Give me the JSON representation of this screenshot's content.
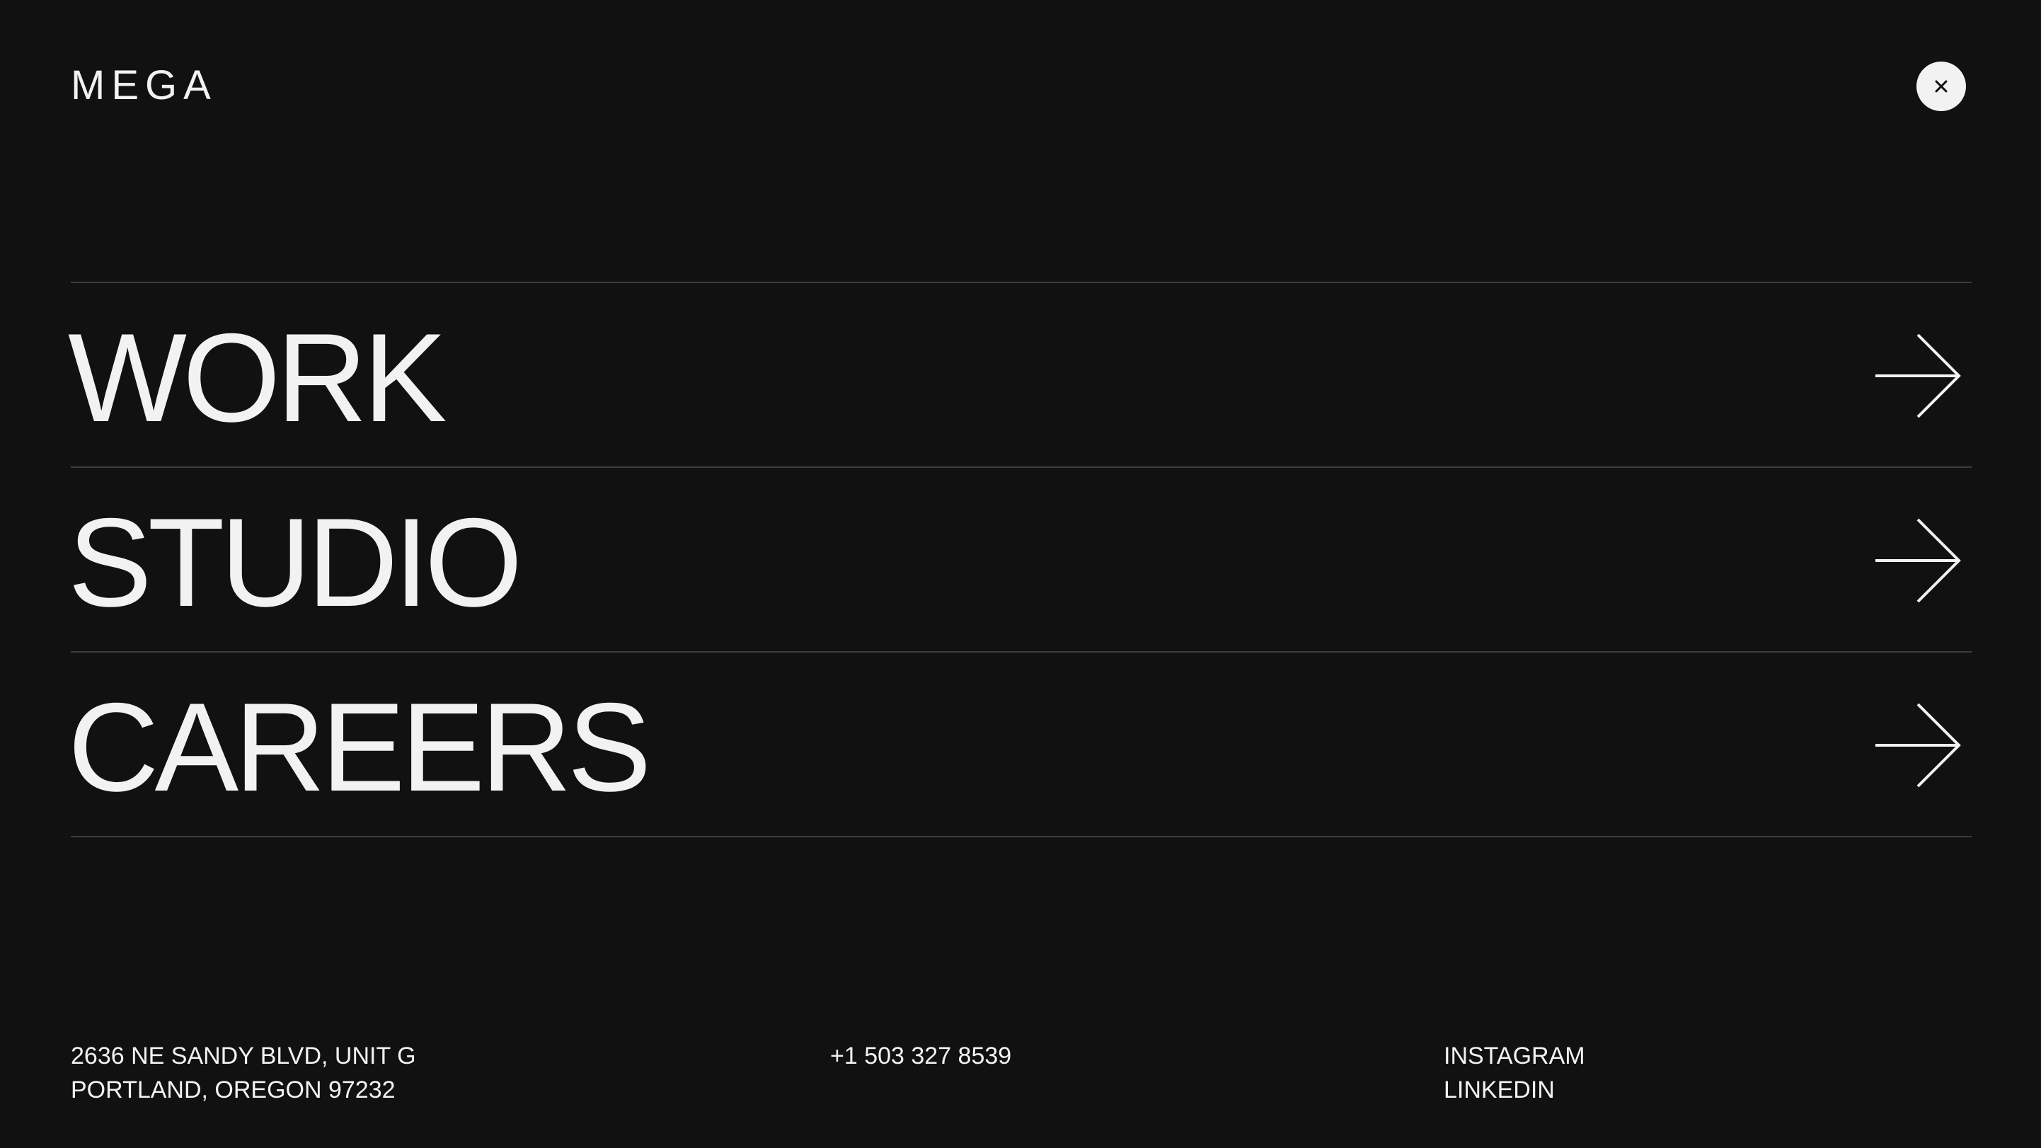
{
  "header": {
    "logo": "MEGA",
    "close_icon": "close-icon"
  },
  "nav": {
    "items": [
      {
        "label": "WORK",
        "icon": "arrow-right-icon"
      },
      {
        "label": "STUDIO",
        "icon": "arrow-right-icon"
      },
      {
        "label": "CAREERS",
        "icon": "arrow-right-icon"
      }
    ]
  },
  "footer": {
    "address": {
      "line1": "2636 NE SANDY BLVD, UNIT G",
      "line2": "PORTLAND, OREGON 97232"
    },
    "phone": "+1 503 327 8539",
    "social": {
      "instagram": "INSTAGRAM",
      "linkedin": "LINKEDIN"
    }
  },
  "colors": {
    "background": "#111111",
    "text": "#f2f2f2",
    "divider": "#3d3d3d"
  }
}
